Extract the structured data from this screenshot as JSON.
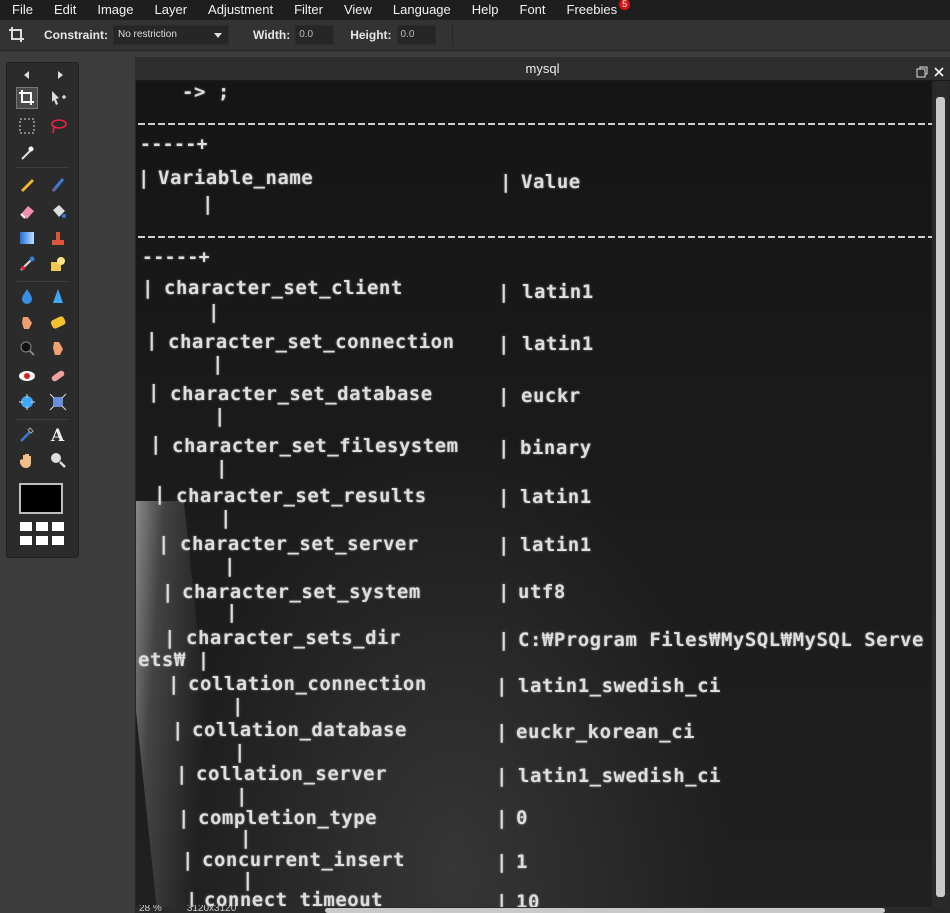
{
  "menu": {
    "items": [
      "File",
      "Edit",
      "Image",
      "Layer",
      "Adjustment",
      "Filter",
      "View",
      "Language",
      "Help",
      "Font",
      "Freebies"
    ],
    "freebies_badge": "5"
  },
  "options": {
    "constraint_label": "Constraint:",
    "constraint_value": "No restriction",
    "width_label": "Width:",
    "width_value": "0.0",
    "height_label": "Height:",
    "height_value": "0.0"
  },
  "document": {
    "title": "mysql",
    "status_zoom": "28 %",
    "status_size": "3120x3120"
  },
  "terminal": {
    "prompt": "-> ;",
    "header_tail": "-----+",
    "col1": "Variable_name",
    "col2": "Value",
    "rows": [
      {
        "name": "character_set_client",
        "value": "latin1"
      },
      {
        "name": "character_set_connection",
        "value": "latin1"
      },
      {
        "name": "character_set_database",
        "value": "euckr"
      },
      {
        "name": "character_set_filesystem",
        "value": "binary"
      },
      {
        "name": "character_set_results",
        "value": "latin1"
      },
      {
        "name": "character_set_server",
        "value": "latin1"
      },
      {
        "name": "character_set_system",
        "value": "utf8"
      },
      {
        "name": "character_sets_dir",
        "value": "C:₩Program Files₩MySQL₩MySQL Serve"
      },
      {
        "name": "collation_connection",
        "value": "latin1_swedish_ci"
      },
      {
        "name": "collation_database",
        "value": "euckr_korean_ci"
      },
      {
        "name": "collation_server",
        "value": "latin1_swedish_ci"
      },
      {
        "name": "completion_type",
        "value": "0"
      },
      {
        "name": "concurrent_insert",
        "value": "1"
      },
      {
        "name": "connect_timeout",
        "value": "10"
      }
    ],
    "sets_wrap": "ets₩ |"
  }
}
